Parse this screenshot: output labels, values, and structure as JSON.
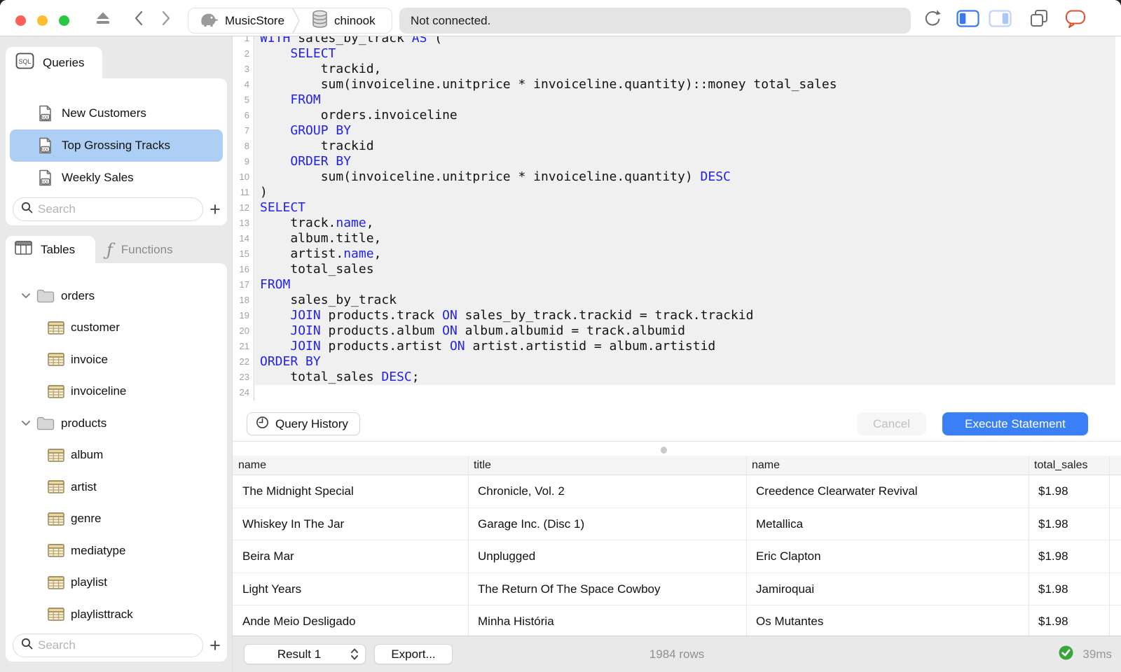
{
  "titlebar": {
    "breadcrumb": [
      {
        "icon": "postgres-elephant-icon",
        "label": "MusicStore"
      },
      {
        "icon": "database-icon",
        "label": "chinook"
      }
    ],
    "status_message": "Not connected."
  },
  "sidebar": {
    "queries": {
      "tab_label": "Queries",
      "items": [
        {
          "label": "New Customers",
          "selected": false
        },
        {
          "label": "Top Grossing Tracks",
          "selected": true
        },
        {
          "label": "Weekly Sales",
          "selected": false
        }
      ],
      "search_placeholder": "Search"
    },
    "schema": {
      "tables_tab_label": "Tables",
      "functions_tab_label": "Functions",
      "tree": [
        {
          "kind": "folder",
          "label": "orders",
          "expanded": true
        },
        {
          "kind": "table",
          "label": "customer"
        },
        {
          "kind": "table",
          "label": "invoice"
        },
        {
          "kind": "table",
          "label": "invoiceline"
        },
        {
          "kind": "folder",
          "label": "products",
          "expanded": true
        },
        {
          "kind": "table",
          "label": "album"
        },
        {
          "kind": "table",
          "label": "artist"
        },
        {
          "kind": "table",
          "label": "genre"
        },
        {
          "kind": "table",
          "label": "mediatype"
        },
        {
          "kind": "table",
          "label": "playlist"
        },
        {
          "kind": "table",
          "label": "playlisttrack"
        }
      ],
      "search_placeholder": "Search"
    }
  },
  "editor": {
    "query_history_label": "Query History",
    "cancel_label": "Cancel",
    "execute_label": "Execute Statement",
    "lines": [
      {
        "n": 1,
        "segs": [
          [
            "WITH",
            "k"
          ],
          [
            " sales_by_track ",
            ""
          ],
          [
            "AS",
            "k"
          ],
          [
            " (",
            ""
          ]
        ]
      },
      {
        "n": 2,
        "segs": [
          [
            "    ",
            ""
          ],
          [
            "SELECT",
            "k"
          ]
        ]
      },
      {
        "n": 3,
        "segs": [
          [
            "        trackid,",
            ""
          ]
        ]
      },
      {
        "n": 4,
        "segs": [
          [
            "        sum(invoiceline.unitprice * invoiceline.quantity)::money total_sales",
            ""
          ]
        ]
      },
      {
        "n": 5,
        "segs": [
          [
            "    ",
            ""
          ],
          [
            "FROM",
            "k"
          ]
        ]
      },
      {
        "n": 6,
        "segs": [
          [
            "        orders.invoiceline",
            ""
          ]
        ]
      },
      {
        "n": 7,
        "segs": [
          [
            "    ",
            ""
          ],
          [
            "GROUP BY",
            "k"
          ]
        ]
      },
      {
        "n": 8,
        "segs": [
          [
            "        trackid",
            ""
          ]
        ]
      },
      {
        "n": 9,
        "segs": [
          [
            "    ",
            ""
          ],
          [
            "ORDER BY",
            "k"
          ]
        ]
      },
      {
        "n": 10,
        "segs": [
          [
            "        sum(invoiceline.unitprice * invoiceline.quantity) ",
            ""
          ],
          [
            "DESC",
            "k"
          ]
        ]
      },
      {
        "n": 11,
        "segs": [
          [
            ")",
            ""
          ]
        ]
      },
      {
        "n": 12,
        "segs": [
          [
            "SELECT",
            "k"
          ]
        ]
      },
      {
        "n": 13,
        "segs": [
          [
            "    track.",
            ""
          ],
          [
            "name",
            "k"
          ],
          [
            ",",
            ""
          ]
        ]
      },
      {
        "n": 14,
        "segs": [
          [
            "    album.title,",
            ""
          ]
        ]
      },
      {
        "n": 15,
        "segs": [
          [
            "    artist.",
            ""
          ],
          [
            "name",
            "k"
          ],
          [
            ",",
            ""
          ]
        ]
      },
      {
        "n": 16,
        "segs": [
          [
            "    total_sales",
            ""
          ]
        ]
      },
      {
        "n": 17,
        "segs": [
          [
            "FROM",
            "k"
          ]
        ]
      },
      {
        "n": 18,
        "segs": [
          [
            "    sales_by_track",
            ""
          ]
        ]
      },
      {
        "n": 19,
        "segs": [
          [
            "    ",
            ""
          ],
          [
            "JOIN",
            "k"
          ],
          [
            " products.track ",
            ""
          ],
          [
            "ON",
            "k"
          ],
          [
            " sales_by_track.trackid = track.trackid",
            ""
          ]
        ]
      },
      {
        "n": 20,
        "segs": [
          [
            "    ",
            ""
          ],
          [
            "JOIN",
            "k"
          ],
          [
            " products.album ",
            ""
          ],
          [
            "ON",
            "k"
          ],
          [
            " album.albumid = track.albumid",
            ""
          ]
        ]
      },
      {
        "n": 21,
        "segs": [
          [
            "    ",
            ""
          ],
          [
            "JOIN",
            "k"
          ],
          [
            " products.artist ",
            ""
          ],
          [
            "ON",
            "k"
          ],
          [
            " artist.artistid = album.artistid",
            ""
          ]
        ]
      },
      {
        "n": 22,
        "segs": [
          [
            "ORDER BY",
            "k"
          ]
        ]
      },
      {
        "n": 23,
        "segs": [
          [
            "    total_sales ",
            ""
          ],
          [
            "DESC",
            "k"
          ],
          [
            ";",
            ""
          ]
        ]
      },
      {
        "n": 24,
        "segs": [
          [
            "",
            ""
          ]
        ]
      }
    ]
  },
  "results": {
    "columns": [
      "name",
      "title",
      "name",
      "total_sales"
    ],
    "rows": [
      [
        "The Midnight Special",
        "Chronicle, Vol. 2",
        "Creedence Clearwater Revival",
        "$1.98"
      ],
      [
        "Whiskey In The Jar",
        "Garage Inc. (Disc 1)",
        "Metallica",
        "$1.98"
      ],
      [
        "Beira Mar",
        "Unplugged",
        "Eric Clapton",
        "$1.98"
      ],
      [
        "Light Years",
        "The Return Of The Space Cowboy",
        "Jamiroquai",
        "$1.98"
      ],
      [
        "Ande Meio Desligado",
        "Minha História",
        "Os Mutantes",
        "$1.98"
      ]
    ],
    "statusbar": {
      "result_selector": "Result 1",
      "export_label": "Export...",
      "row_count": "1984 rows",
      "duration": "39ms"
    }
  },
  "colors": {
    "accent_blue": "#3b7ff7",
    "selection_blue": "#aecff5",
    "keyword_blue": "#2222ec",
    "success_green": "#3aa53c",
    "chat_orange": "#de4f2b",
    "statement_highlight": "#f0f0f1"
  }
}
